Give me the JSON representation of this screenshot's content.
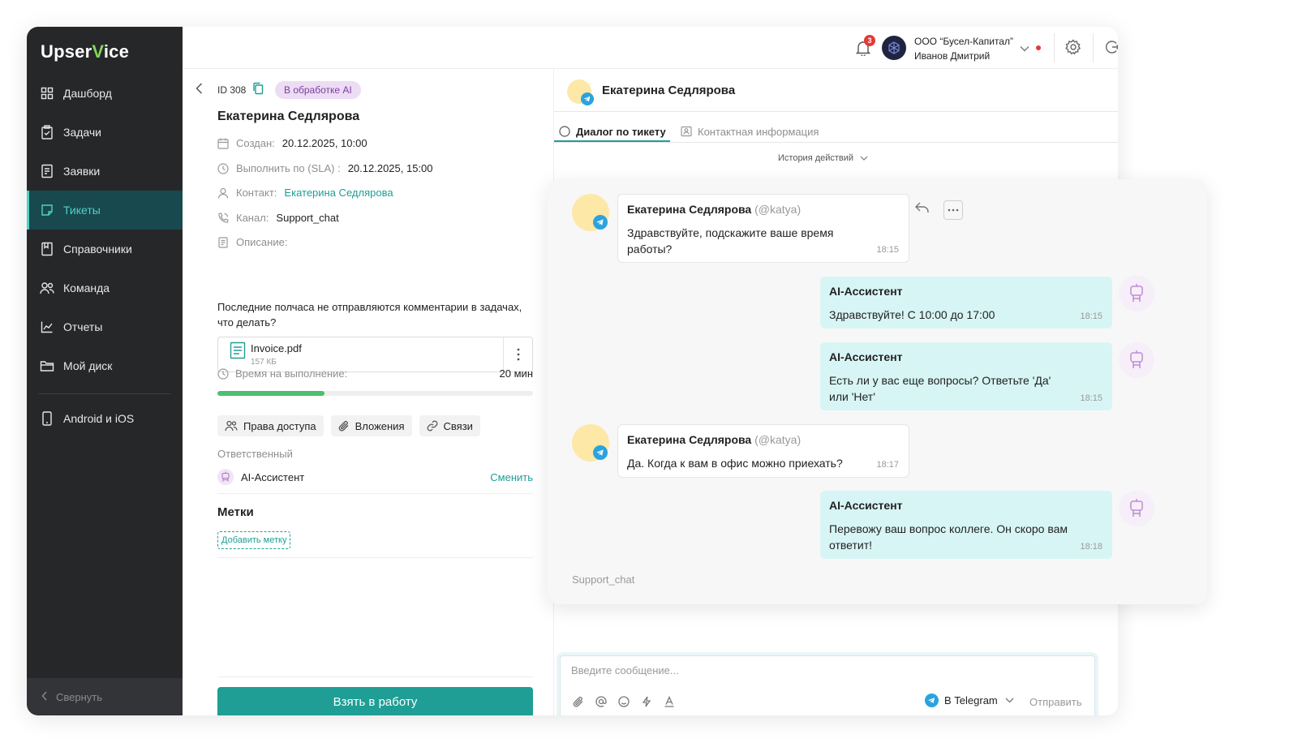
{
  "brand": {
    "name_prefix": "Upser",
    "name_mark": "V",
    "name_suffix": "ice",
    "accent": "#1e9e95",
    "logo_green": "#7ed957"
  },
  "sidebar": {
    "items": [
      {
        "label": "Дашборд",
        "icon": "dashboard-icon"
      },
      {
        "label": "Задачи",
        "icon": "tasks-icon"
      },
      {
        "label": "Заявки",
        "icon": "requests-icon"
      },
      {
        "label": "Тикеты",
        "icon": "tickets-icon",
        "active": true
      },
      {
        "label": "Справочники",
        "icon": "book-icon"
      },
      {
        "label": "Команда",
        "icon": "team-icon"
      },
      {
        "label": "Отчеты",
        "icon": "chart-icon"
      },
      {
        "label": "Мой диск",
        "icon": "folder-icon"
      }
    ],
    "apps_label": "Android и iOS",
    "collapse_label": "Свернуть"
  },
  "header": {
    "notifications_count": "3",
    "company": "ООО “Бусел-Капитал”",
    "user_name": "Иванов Дмитрий"
  },
  "ticket": {
    "id_label": "ID 308",
    "status": "В обработке AI",
    "title": "Екатерина Седлярова",
    "created_label": "Создан:",
    "created_value": "20.12.2025, 10:00",
    "sla_label": "Выполнить по (SLA) :",
    "sla_value": "20.12.2025, 15:00",
    "contact_label": "Контакт:",
    "contact_value": "Екатерина Седлярова",
    "channel_label": "Канал:",
    "channel_value": "Support_chat",
    "description_label": "Описание:",
    "description_text": "Последние полчаса не отправляются комментарии в задачах, что делать?",
    "attachment": {
      "name": "Invoice.pdf",
      "size": "157 КБ"
    },
    "time_label": "Время на выполнение:",
    "time_value": "20 мин",
    "time_progress": 0.34,
    "chips": {
      "access": "Права доступа",
      "attachments": "Вложения",
      "links": "Связи"
    },
    "responsible_label": "Ответственный",
    "responsible_name": "AI-Ассистент",
    "change_label": "Сменить",
    "tags_title": "Метки",
    "add_tag_label": "Добавить метку",
    "take_button": "Взять в работу"
  },
  "chat": {
    "contact_name": "Екатерина Седлярова",
    "tab_dialog": "Диалог по тикету",
    "tab_contact": "Контактная информация",
    "history_label": "История действий",
    "messages": [
      {
        "author": "Екатерина Седлярова",
        "handle": "(@katya)",
        "text": "Здравствуйте, подскажите ваше время работы?",
        "time": "18:15"
      },
      {
        "author": "AI-Ассистент",
        "text": "Здравствуйте! С 10:00 до 17:00",
        "time": "18:15"
      },
      {
        "author": "AI-Ассистент",
        "text": "Есть ли у вас еще вопросы? Ответьте 'Да' или 'Нет'",
        "time": "18:15"
      },
      {
        "author": "Екатерина Седлярова",
        "handle": "(@katya)",
        "text": "Да. Когда к вам в офис можно приехать?",
        "time": "18:17"
      },
      {
        "author": "AI-Ассистент",
        "text": "Перевожу ваш вопрос коллеге. Он скоро вам ответит!",
        "time": "18:18"
      }
    ],
    "channel_note": "Support_chat",
    "composer_placeholder": "Введите сообщение...",
    "send_via": "В Telegram",
    "send_label": "Отправить"
  }
}
